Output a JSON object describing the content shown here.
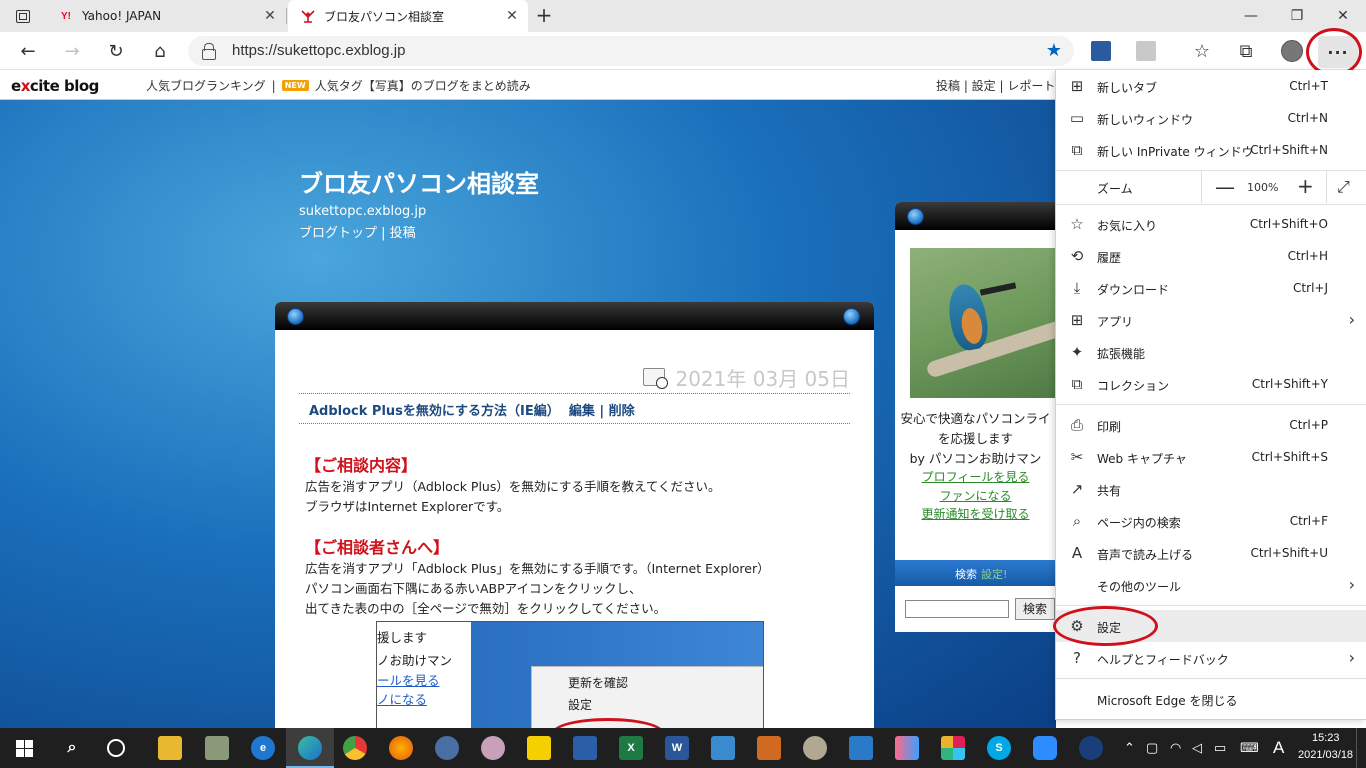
{
  "tabs": [
    {
      "title": "Yahoo! JAPAN",
      "favicon": "Y!"
    },
    {
      "title": "ブロ友パソコン相談室",
      "favicon": "excite"
    }
  ],
  "address": {
    "url": "https://sukettopc.exblog.jp"
  },
  "excite": {
    "logo_e": "e",
    "logo_x": "x",
    "logo_rest": "cite blog",
    "ranking_link": "人気ブログランキング",
    "sep": "|",
    "new_badge": "NEW",
    "tag_link": "人気タグ【写真】のブログをまとめ読み",
    "right_links": "投稿 | 設定 | レポート"
  },
  "blog": {
    "title": "ブロ友パソコン相談室",
    "domain": "sukettopc.exblog.jp",
    "links": "ブログトップ | 投稿"
  },
  "post": {
    "date": "2021年 03月 05日",
    "title": "Adblock Plusを無効にする方法（IE編）",
    "edit_links": "編集 | 削除",
    "section1_head": "【ご相談内容】",
    "section1_lines": [
      "広告を消すアプリ（Adblock Plus）を無効にする手順を教えてください。",
      "ブラウザはInternet Explorerです。"
    ],
    "section2_head": "【ご相談者さんへ】",
    "section2_lines": [
      "広告を消すアプリ「Adblock Plus」を無効にする手順です。（Internet Explorer）",
      "パソコン画面右下隅にある赤いABPアイコンをクリックし、",
      "出てきた表の中の［全ページで無効］をクリックしてください。"
    ],
    "screenshot_left": [
      "援します",
      "ノお助けマン",
      "ールを見る",
      "ノになる"
    ],
    "screenshot_menu": [
      "更新を確認",
      "設定"
    ]
  },
  "sidebar": {
    "desc_lines": [
      "安心で快適なパソコンライ",
      "を応援します",
      "by パソコンお助けマン"
    ],
    "links": [
      "プロフィールを見る",
      "ファンになる",
      "更新通知を受け取る"
    ],
    "search_label": "検索",
    "search_sub": "設定!",
    "search_button": "検索"
  },
  "menu": {
    "items": [
      {
        "icon": "new-tab-icon",
        "glyph": "⊞",
        "label": "新しいタブ",
        "shortcut": "Ctrl+T"
      },
      {
        "icon": "new-window-icon",
        "glyph": "▭",
        "label": "新しいウィンドウ",
        "shortcut": "Ctrl+N"
      },
      {
        "icon": "inprivate-icon",
        "glyph": "⧉",
        "label": "新しい InPrivate ウィンドウ",
        "shortcut": "Ctrl+Shift+N"
      },
      {
        "icon": "favorites-icon",
        "glyph": "☆",
        "label": "お気に入り",
        "shortcut": "Ctrl+Shift+O"
      },
      {
        "icon": "history-icon",
        "glyph": "⟲",
        "label": "履歴",
        "shortcut": "Ctrl+H"
      },
      {
        "icon": "download-icon",
        "glyph": "⤓",
        "label": "ダウンロード",
        "shortcut": "Ctrl+J"
      },
      {
        "icon": "apps-icon",
        "glyph": "⊞",
        "label": "アプリ",
        "shortcut": ""
      },
      {
        "icon": "extensions-icon",
        "glyph": "✦",
        "label": "拡張機能",
        "shortcut": ""
      },
      {
        "icon": "collections-icon",
        "glyph": "⧉",
        "label": "コレクション",
        "shortcut": "Ctrl+Shift+Y"
      },
      {
        "icon": "print-icon",
        "glyph": "⎙",
        "label": "印刷",
        "shortcut": "Ctrl+P"
      },
      {
        "icon": "web-capture-icon",
        "glyph": "✂",
        "label": "Web キャプチャ",
        "shortcut": "Ctrl+Shift+S"
      },
      {
        "icon": "share-icon",
        "glyph": "↗",
        "label": "共有",
        "shortcut": ""
      },
      {
        "icon": "find-icon",
        "glyph": "⌕",
        "label": "ページ内の検索",
        "shortcut": "Ctrl+F"
      },
      {
        "icon": "read-aloud-icon",
        "glyph": "A",
        "label": "音声で読み上げる",
        "shortcut": "Ctrl+Shift+U"
      },
      {
        "icon": "more-tools-icon",
        "glyph": "",
        "label": "その他のツール",
        "shortcut": ""
      },
      {
        "icon": "settings-icon",
        "glyph": "⚙",
        "label": "設定",
        "shortcut": ""
      },
      {
        "icon": "help-icon",
        "glyph": "?",
        "label": "ヘルプとフィードバック",
        "shortcut": ""
      },
      {
        "icon": "close-edge-icon",
        "glyph": "",
        "label": "Microsoft Edge を閉じる",
        "shortcut": ""
      }
    ],
    "zoom_label": "ズーム",
    "zoom_minus": "—",
    "zoom_value": "100%",
    "zoom_plus": "+",
    "zoom_full": "⤢"
  },
  "taskbar": {
    "time": "15:23",
    "date": "2021/03/18",
    "ime": "A"
  },
  "colors": {
    "accent": "#0067c0",
    "annotation_ring": "#d0101a",
    "blog_blue": "#1a6fbb"
  }
}
